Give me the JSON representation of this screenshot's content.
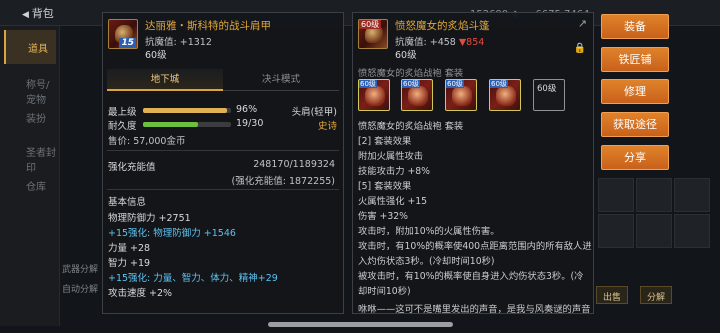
{
  "background": {
    "back_label": "背包",
    "topbar_right": "152690 ◆ 　 6675 7464",
    "sidebar": [
      {
        "label": "道具",
        "active": true
      },
      {
        "label": "称号/宠物",
        "active": false
      },
      {
        "label": "装扮",
        "active": false
      },
      {
        "label": "圣者封印",
        "active": false
      },
      {
        "label": "仓库",
        "active": false
      }
    ],
    "bottom_left": [
      "武器分解",
      "自动分解"
    ],
    "bottom_buttons": [
      "出售",
      "分解"
    ]
  },
  "left_item": {
    "name": "达丽雅・斯科特的战斗肩甲",
    "badge": "15",
    "resist_label": "抗魔值: ",
    "resist_value": "+1312",
    "level": "60级",
    "tabs": [
      "地下城",
      "决斗模式"
    ],
    "stats": {
      "level_label": "最上级",
      "level_pct": "96%",
      "level_fraction": 0.96,
      "durability_label": "耐久度",
      "durability_value": "19/30",
      "durability_fraction": 0.63,
      "slot": "头肩(轻甲)",
      "rarity": "史诗",
      "price": "售价: 57,000金币"
    },
    "enhance": {
      "label": "强化充能值",
      "value": "248170/1189324",
      "sub": "(强化充能值: 1872255)"
    },
    "basic_info": {
      "title": "基本信息",
      "lines": [
        {
          "text": "物理防御力 +2751",
          "color": "normal"
        },
        {
          "text": "+15强化: 物理防御力 +1546",
          "color": "blue"
        },
        {
          "text": "力量 +28",
          "color": "normal"
        },
        {
          "text": "智力 +19",
          "color": "normal"
        },
        {
          "text": "+15强化: 力量、智力、体力、精神+29",
          "color": "blue"
        },
        {
          "text": "攻击速度 +2%",
          "color": "normal"
        }
      ]
    }
  },
  "right_item": {
    "name": "愤怒魔女的炙焰斗篷",
    "icon_tag": "60级",
    "resist_label": "抗魔值: ",
    "resist_value": "+458",
    "resist_delta": "▼854",
    "level": "60级",
    "set_header": "愤怒魔女的炙焰战袍  套装",
    "set_icons": [
      {
        "tag": "60级",
        "filled": true
      },
      {
        "tag": "60级",
        "filled": true
      },
      {
        "tag": "60级",
        "filled": true
      },
      {
        "tag": "60级",
        "filled": true
      },
      {
        "tag": "60级",
        "filled": false
      }
    ],
    "lines": [
      "愤怒魔女的炙焰战袍  套装",
      "[2] 套装效果",
      "附加火属性攻击",
      "技能攻击力 +8%",
      "[5] 套装效果",
      "火属性强化 +15",
      "伤害 +32%",
      "攻击时，附加10%的火属性伤害。",
      "攻击时，有10%的概率使400点距离范围内的所有敌人进",
      "入灼伤状态3秒。(冷却时间10秒)",
      "被攻击时，有10%的概率使自身进入灼伤状态3秒。(冷",
      "却时间10秒)",
      "咻咻——这可不是嘴里发出的声音，是我与风奏谜的声音"
    ]
  },
  "actions": [
    "装备",
    "铁匠铺",
    "修理",
    "获取途径",
    "分享"
  ],
  "colors": {
    "item_name": "#e0a63b",
    "blue_stat": "#5dc2f0",
    "down_red": "#e24b43",
    "action_orange": "#d8701f"
  }
}
